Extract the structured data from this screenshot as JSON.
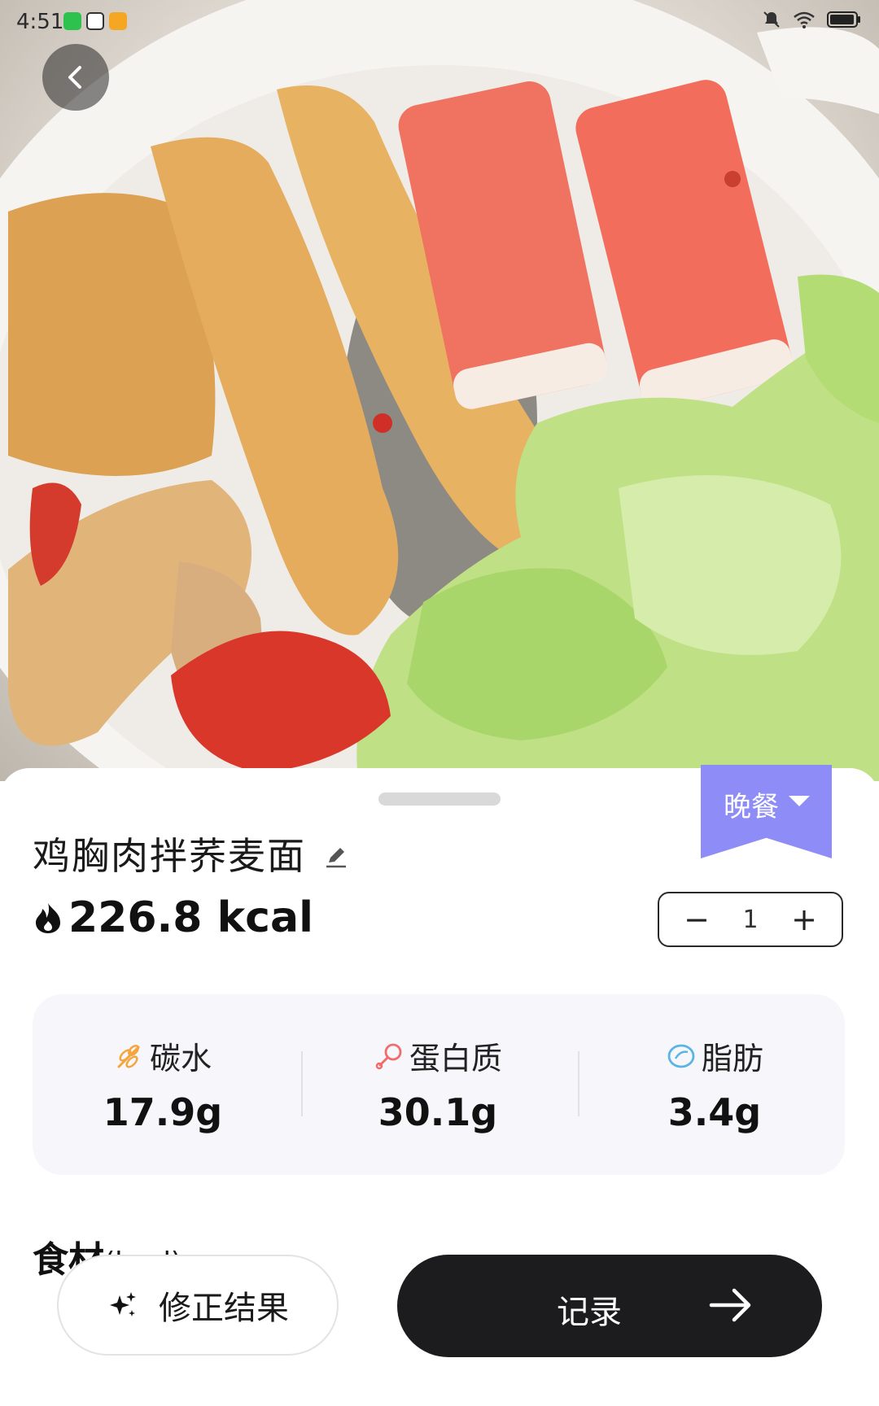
{
  "status_bar": {
    "time": "4:51"
  },
  "meal": {
    "tag": "晚餐",
    "food_name": "鸡胸肉拌荞麦面",
    "calories": "226.8 kcal",
    "quantity": "1"
  },
  "macros": [
    {
      "name": "碳水",
      "value": "17.9g",
      "icon": "wheat-icon",
      "color": "#f4a53c"
    },
    {
      "name": "蛋白质",
      "value": "30.1g",
      "icon": "drumstick-icon",
      "color": "#f06b6b"
    },
    {
      "name": "脂肪",
      "value": "3.4g",
      "icon": "oil-drop-icon",
      "color": "#5ab4e6"
    }
  ],
  "ingredients": {
    "title": "食材",
    "unit": "(kcal)"
  },
  "actions": {
    "fix_label": "修正结果",
    "record_label": "记录"
  },
  "colors": {
    "meal_tag": "#8e8cf6",
    "primary_button": "#1c1c1e"
  }
}
